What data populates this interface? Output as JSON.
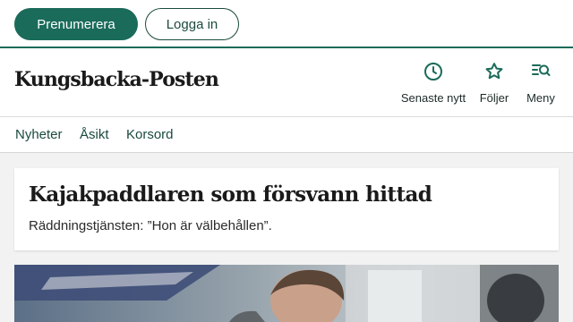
{
  "topbar": {
    "subscribe_label": "Prenumerera",
    "login_label": "Logga in"
  },
  "masthead": {
    "logo_text": "Kungsbacka-Posten",
    "nav_buttons": [
      {
        "label": "Senaste nytt",
        "icon": "clock-icon"
      },
      {
        "label": "Följer",
        "icon": "star-icon"
      },
      {
        "label": "Meny",
        "icon": "menu-search-icon"
      }
    ]
  },
  "sections": {
    "items": [
      {
        "label": "Nyheter"
      },
      {
        "label": "Åsikt"
      },
      {
        "label": "Korsord"
      }
    ]
  },
  "article": {
    "headline": "Kajakpaddlaren som försvann hittad",
    "subheadline": "Räddningstjänsten: ”Hon är välbehållen”.",
    "image": "news-photo"
  },
  "colors": {
    "brand_green": "#1a6b5a",
    "text_dark": "#1a1a1a",
    "page_bg": "#f2f2f2"
  }
}
